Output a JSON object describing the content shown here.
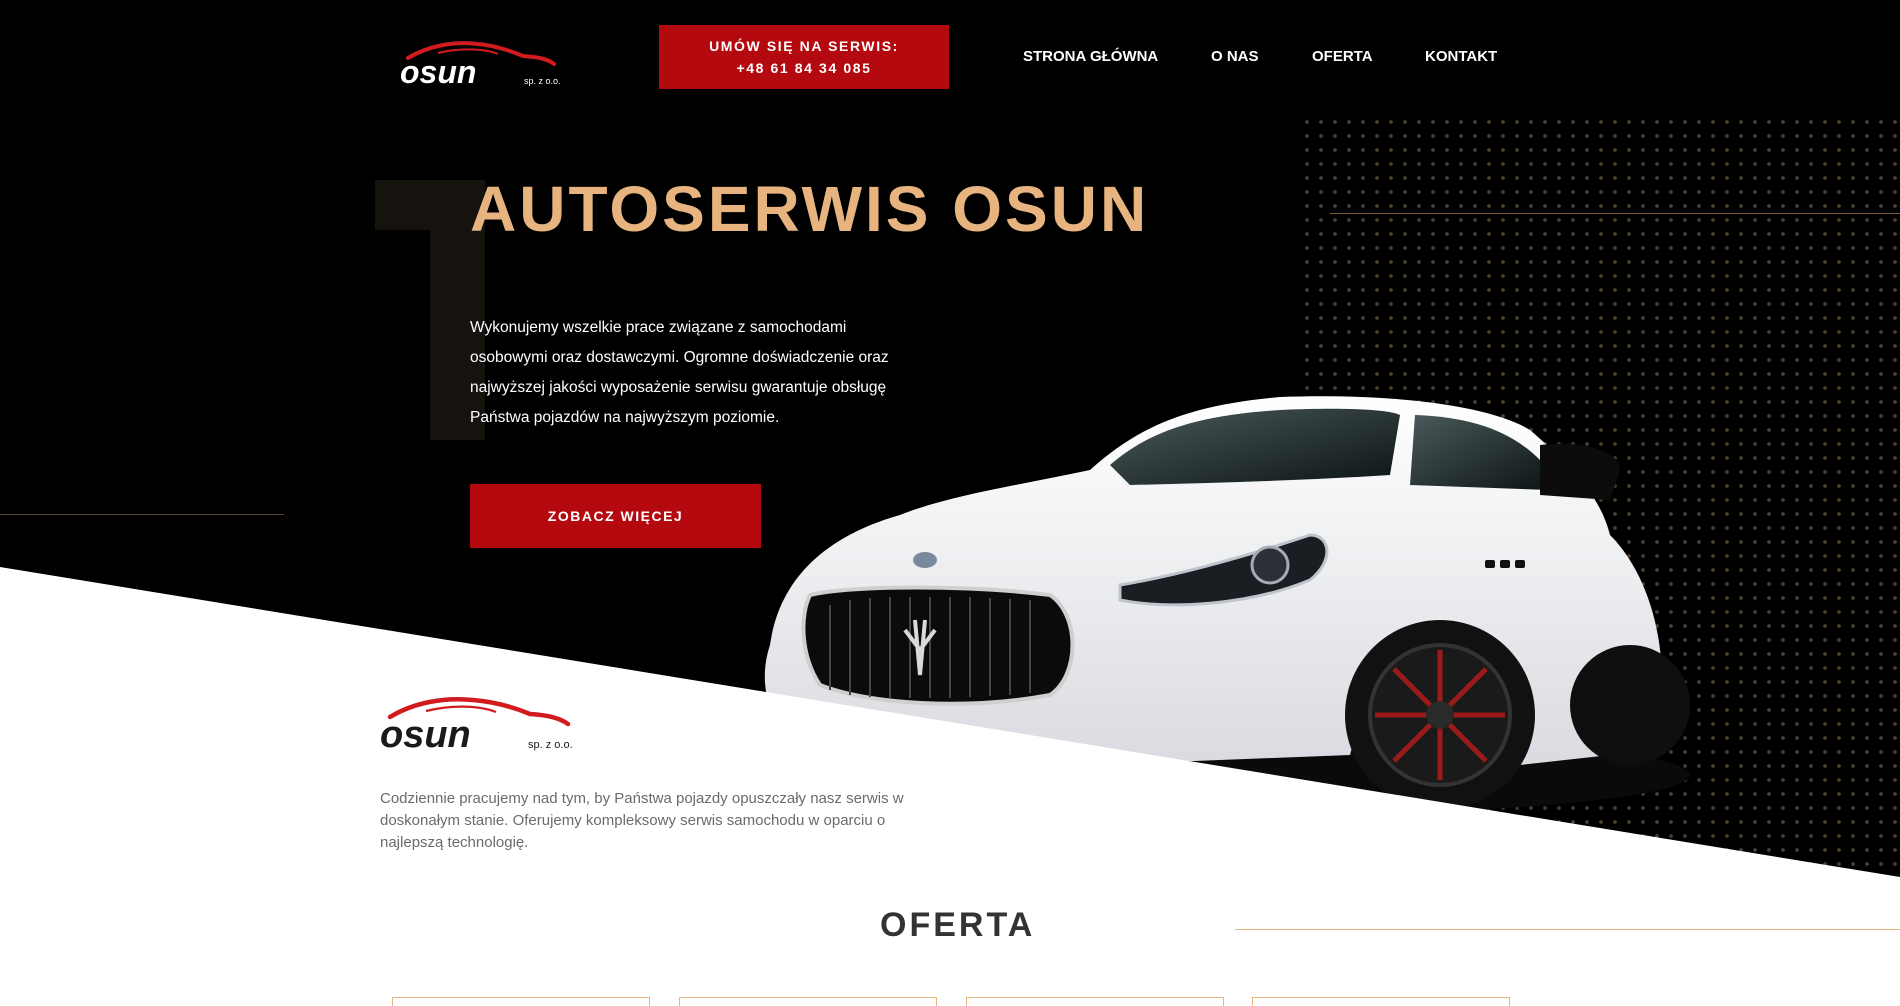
{
  "header": {
    "logo_text": "osun",
    "logo_sub": "sp. z o.o.",
    "cta_line1": "UMÓW SIĘ NA SERWIS:",
    "cta_line2": "+48 61 84 34 085"
  },
  "nav": {
    "items": [
      "STRONA GŁÓWNA",
      "O NAS",
      "OFERTA",
      "KONTAKT"
    ]
  },
  "hero": {
    "title": "AUTOSERWIS OSUN",
    "text_lines": [
      "Wykonujemy wszelkie prace związane z samochodami",
      "osobowymi oraz dostawczymi. Ogromne doświadczenie oraz",
      "najwyższej jakości wyposażenie serwisu gwarantuje obsługę",
      "Państwa pojazdów na najwyższym poziomie."
    ],
    "button": "ZOBACZ WIĘCEJ"
  },
  "about": {
    "logo_text": "osun",
    "logo_sub": "sp. z o.o.",
    "text_lines": [
      "Codziennie pracujemy nad tym, by Państwa pojazdy opuszczały nasz serwis w",
      "doskonałym stanie. Oferujemy kompleksowy serwis samochodu w oparciu o",
      "najlepszą technologię."
    ]
  },
  "offer": {
    "title": "OFERTA"
  },
  "colors": {
    "accent_red": "#b40a0f",
    "accent_gold": "#e7b47f",
    "background_dark": "#000000"
  },
  "icons": {
    "logo": "car-silhouette-logo-icon"
  }
}
